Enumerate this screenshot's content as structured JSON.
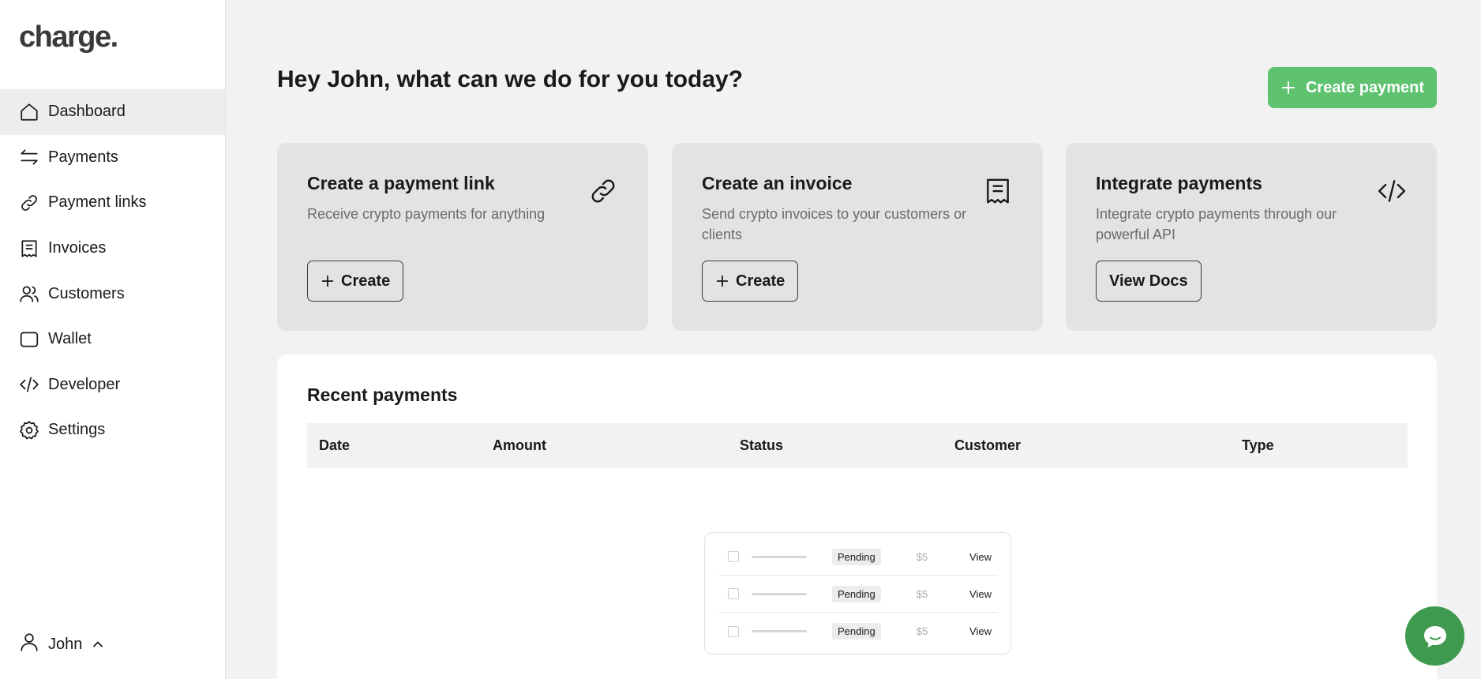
{
  "app": {
    "logo": "charge."
  },
  "sidebar": {
    "items": [
      {
        "label": "Dashboard",
        "icon": "home-icon",
        "active": true
      },
      {
        "label": "Payments",
        "icon": "arrows-icon"
      },
      {
        "label": "Payment links",
        "icon": "link-icon"
      },
      {
        "label": "Invoices",
        "icon": "receipt-icon"
      },
      {
        "label": "Customers",
        "icon": "users-icon"
      },
      {
        "label": "Wallet",
        "icon": "wallet-icon"
      },
      {
        "label": "Developer",
        "icon": "code-icon"
      },
      {
        "label": "Settings",
        "icon": "gear-icon"
      }
    ],
    "user": {
      "name": "John",
      "icon": "user-icon",
      "chevron": "chevron-up-icon"
    }
  },
  "main": {
    "greeting": "Hey John, what can we do for you today?",
    "create_payment_label": "Create payment",
    "cards": [
      {
        "title": "Create a payment link",
        "description": "Receive crypto payments for anything",
        "button": "Create",
        "icon": "link-icon"
      },
      {
        "title": "Create an invoice",
        "description": "Send crypto invoices to your customers or clients",
        "button": "Create",
        "icon": "receipt-icon"
      },
      {
        "title": "Integrate payments",
        "description": "Integrate crypto payments through our powerful API",
        "button": "View Docs",
        "icon": "code-icon"
      }
    ],
    "recent": {
      "title": "Recent payments",
      "columns": [
        "Date",
        "Amount",
        "Status",
        "Customer",
        "Type"
      ],
      "empty_rows": [
        {
          "status": "Pending",
          "amount": "$5",
          "action": "View"
        },
        {
          "status": "Pending",
          "amount": "$5",
          "action": "View"
        },
        {
          "status": "Pending",
          "amount": "$5",
          "action": "View"
        }
      ]
    }
  },
  "colors": {
    "accent": "#5ec26f",
    "chat": "#3f9a4f",
    "background": "#f2f2f2",
    "card": "#e3e3e3"
  }
}
